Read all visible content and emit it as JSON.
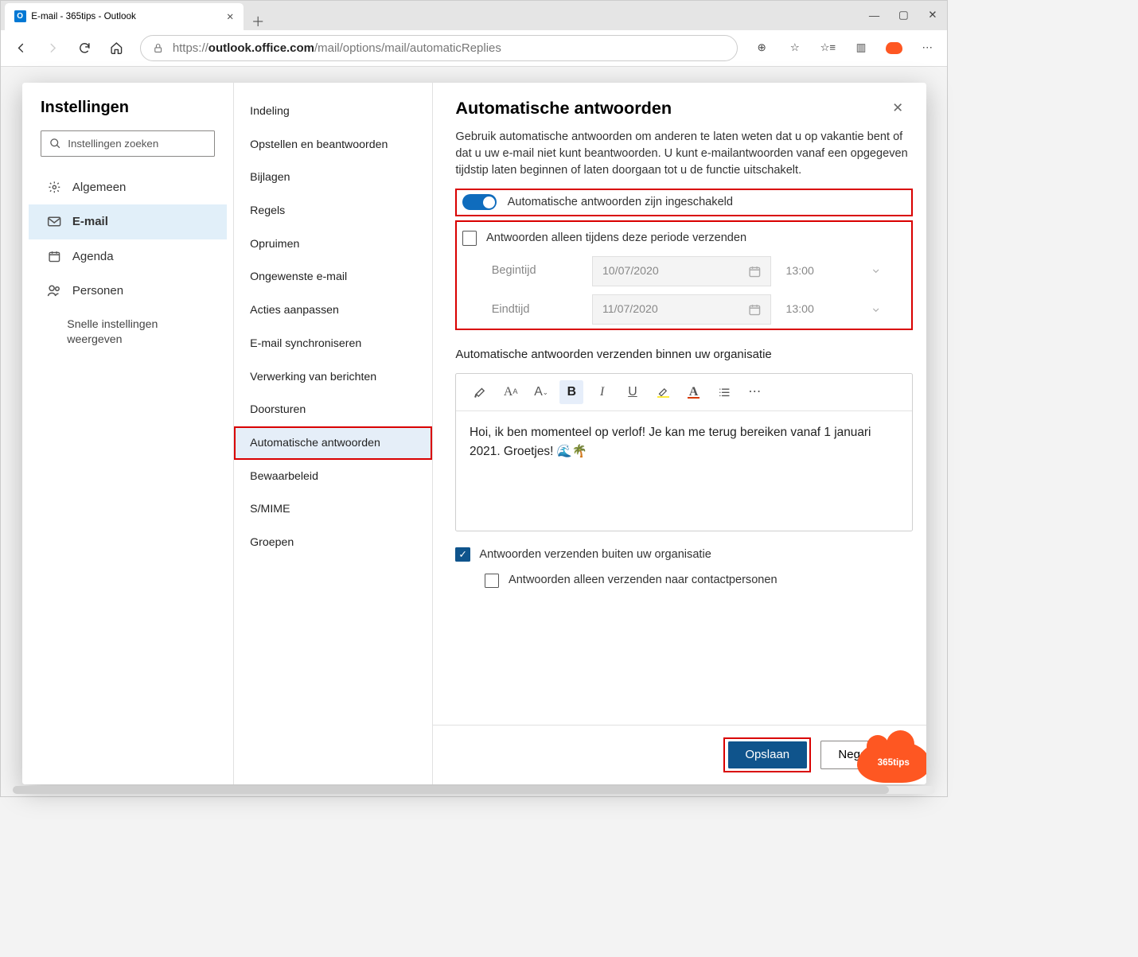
{
  "browser": {
    "tab_title": "E-mail - 365tips - Outlook",
    "url_prefix": "https://",
    "url_host": "outlook.office.com",
    "url_path": "/mail/options/mail/automaticReplies"
  },
  "col1": {
    "title": "Instellingen",
    "search_placeholder": "Instellingen zoeken",
    "items": [
      {
        "icon": "gear",
        "label": "Algemeen"
      },
      {
        "icon": "mail",
        "label": "E-mail",
        "selected": true
      },
      {
        "icon": "calendar",
        "label": "Agenda"
      },
      {
        "icon": "people",
        "label": "Personen"
      }
    ],
    "quick_link": "Snelle instellingen weergeven"
  },
  "col2": {
    "items": [
      "Indeling",
      "Opstellen en beantwoorden",
      "Bijlagen",
      "Regels",
      "Opruimen",
      "Ongewenste e-mail",
      "Acties aanpassen",
      "E-mail synchroniseren",
      "Verwerking van berichten",
      "Doorsturen",
      "Automatische antwoorden",
      "Bewaarbeleid",
      "S/MIME",
      "Groepen"
    ],
    "selected_index": 10
  },
  "panel": {
    "title": "Automatische antwoorden",
    "intro": "Gebruik automatische antwoorden om anderen te laten weten dat u op vakantie bent of dat u uw e-mail niet kunt beantwoorden. U kunt e-mailantwoorden vanaf een opgegeven tijdstip laten beginnen of laten doorgaan tot u de functie uitschakelt.",
    "toggle_label": "Automatische antwoorden zijn ingeschakeld",
    "toggle_on": true,
    "period_checkbox_label": "Antwoorden alleen tijdens deze periode verzenden",
    "period_checked": false,
    "start_label": "Begintijd",
    "end_label": "Eindtijd",
    "start_date": "10/07/2020",
    "start_time": "13:00",
    "end_date": "11/07/2020",
    "end_time": "13:00",
    "internal_section_label": "Automatische antwoorden verzenden binnen uw organisatie",
    "editor_body": "Hoi, ik ben momenteel op verlof! Je kan me terug bereiken vanaf 1 januari 2021. Groetjes! 🌊🌴",
    "external_checkbox_label": "Antwoorden verzenden buiten uw organisatie",
    "external_checked": true,
    "contacts_only_label": "Antwoorden alleen verzenden naar contactpersonen",
    "contacts_only_checked": false,
    "save_btn": "Opslaan",
    "cancel_btn": "Negeren",
    "badge": "365tips"
  }
}
